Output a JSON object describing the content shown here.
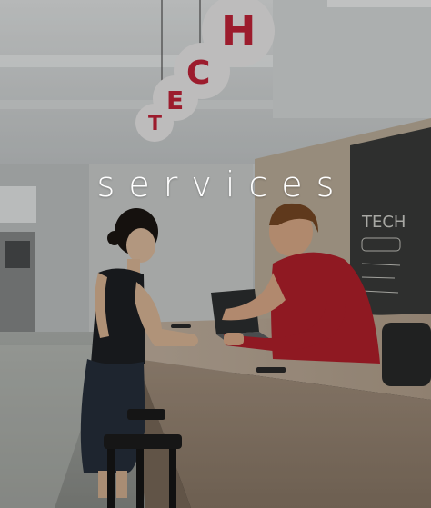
{
  "banner": {
    "title": "services",
    "sign_letters": [
      "T",
      "E",
      "C",
      "H"
    ],
    "chalkboard_heading": "TECH",
    "brand_color": "#c8243a"
  }
}
